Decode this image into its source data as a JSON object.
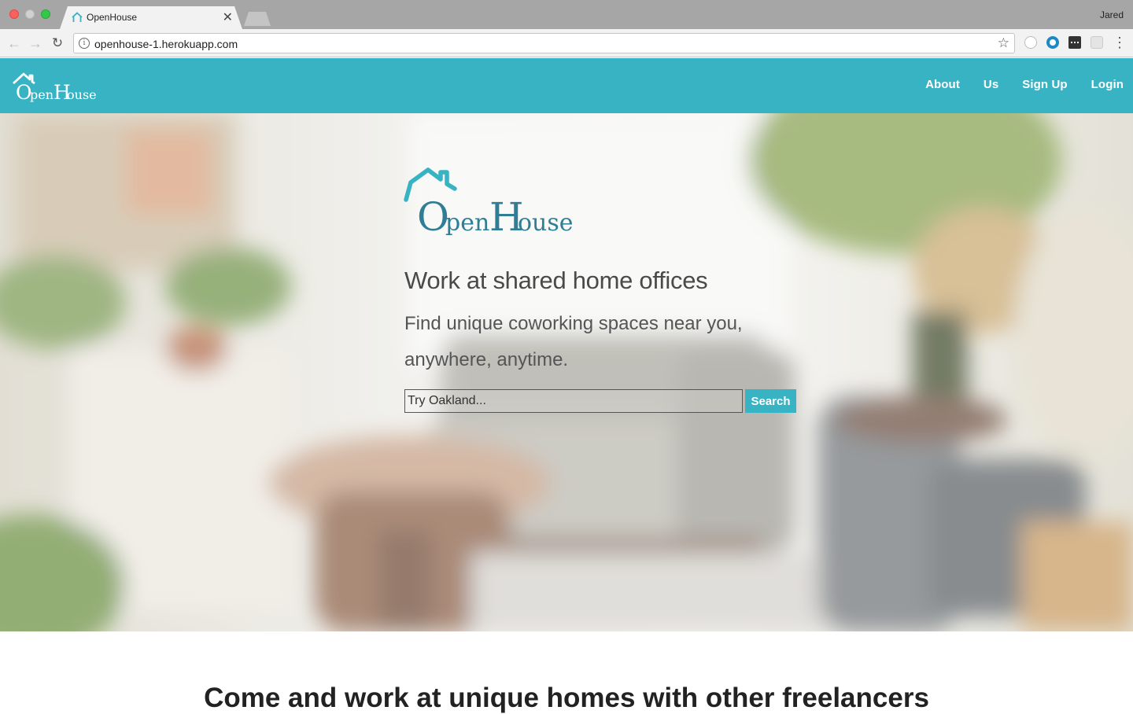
{
  "browser": {
    "tab_title": "OpenHouse",
    "tab_close": "✕",
    "profile_name": "Jared",
    "url": "openhouse-1.herokuapp.com",
    "back_icon": "←",
    "forward_icon": "→",
    "reload_icon": "↻",
    "star_icon": "☆",
    "menu_icon": "⋮"
  },
  "site": {
    "brand": "OpenHouse",
    "brand_color": "#37b3c4",
    "logo_text_color": "#2f7e96",
    "nav_links": [
      "About",
      "Us",
      "Sign Up",
      "Login"
    ]
  },
  "hero": {
    "headline": "Work at shared home offices",
    "subline": "Find unique coworking spaces near you, anywhere, anytime.",
    "search_placeholder": "Try Oakland...",
    "search_button": "Search"
  },
  "section": {
    "title": "Come and work at unique homes with other freelancers"
  }
}
